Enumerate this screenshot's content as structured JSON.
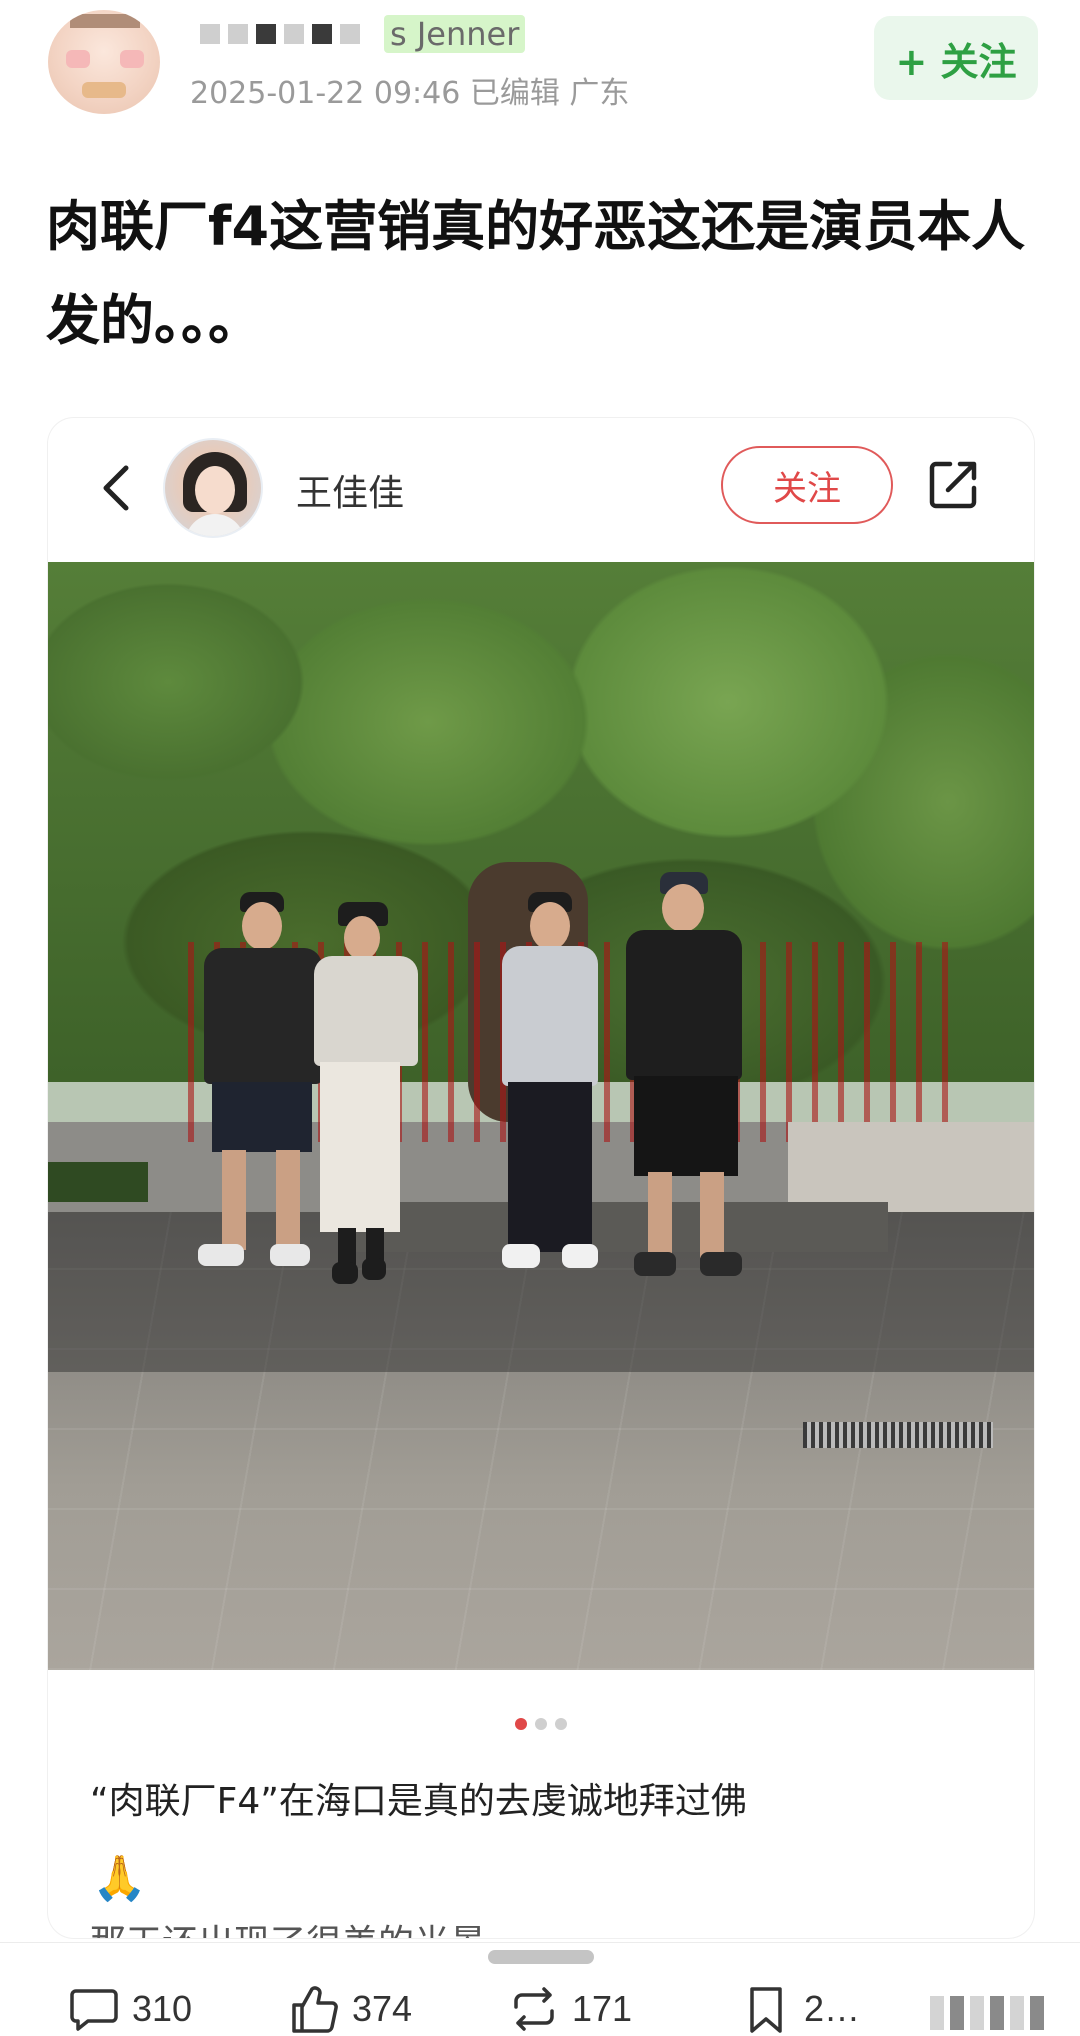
{
  "header": {
    "username_partial": "s Jenner",
    "meta": "2025-01-22 09:46  已编辑  广东",
    "follow_label": "+ 关注"
  },
  "post": {
    "title": "肉联厂f4这营销真的好恶这还是演员本人发的。。。"
  },
  "embedded": {
    "author": "王佳佳",
    "follow_label": "关注",
    "caption": "“肉联厂F4”在海口是真的去虔诚地拜过佛",
    "emoji": "🙏",
    "caption_cutoff": "那天还出现了很美的光景",
    "slides": {
      "active": 0,
      "count": 3
    }
  },
  "actions": {
    "comments": "310",
    "likes": "374",
    "reposts": "171",
    "favorites": "2…"
  },
  "colors": {
    "follow_green": "#2ea043",
    "follow_red": "#e04848",
    "dot_active": "#e04848"
  }
}
